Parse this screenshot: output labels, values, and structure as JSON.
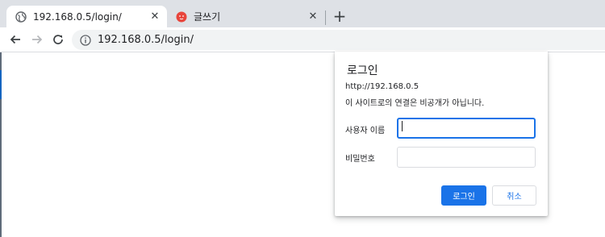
{
  "tabs": [
    {
      "title": "192.168.0.5/login/",
      "favicon": "globe-icon",
      "active": true
    },
    {
      "title": "글쓰기",
      "favicon": "red-circle-favicon",
      "active": false
    }
  ],
  "toolbar": {
    "url": "192.168.0.5/login/"
  },
  "dialog": {
    "title": "로그인",
    "host": "http://192.168.0.5",
    "note": "이 사이트로의 연결은 비공개가 아닙니다.",
    "username_label": "사용자 이름",
    "password_label": "비밀번호",
    "username_value": "",
    "password_value": "",
    "login_button": "로그인",
    "cancel_button": "취소"
  },
  "colors": {
    "accent": "#1a73e8",
    "tabstrip": "#dee1e6",
    "favicon_red": "#e8453c"
  }
}
